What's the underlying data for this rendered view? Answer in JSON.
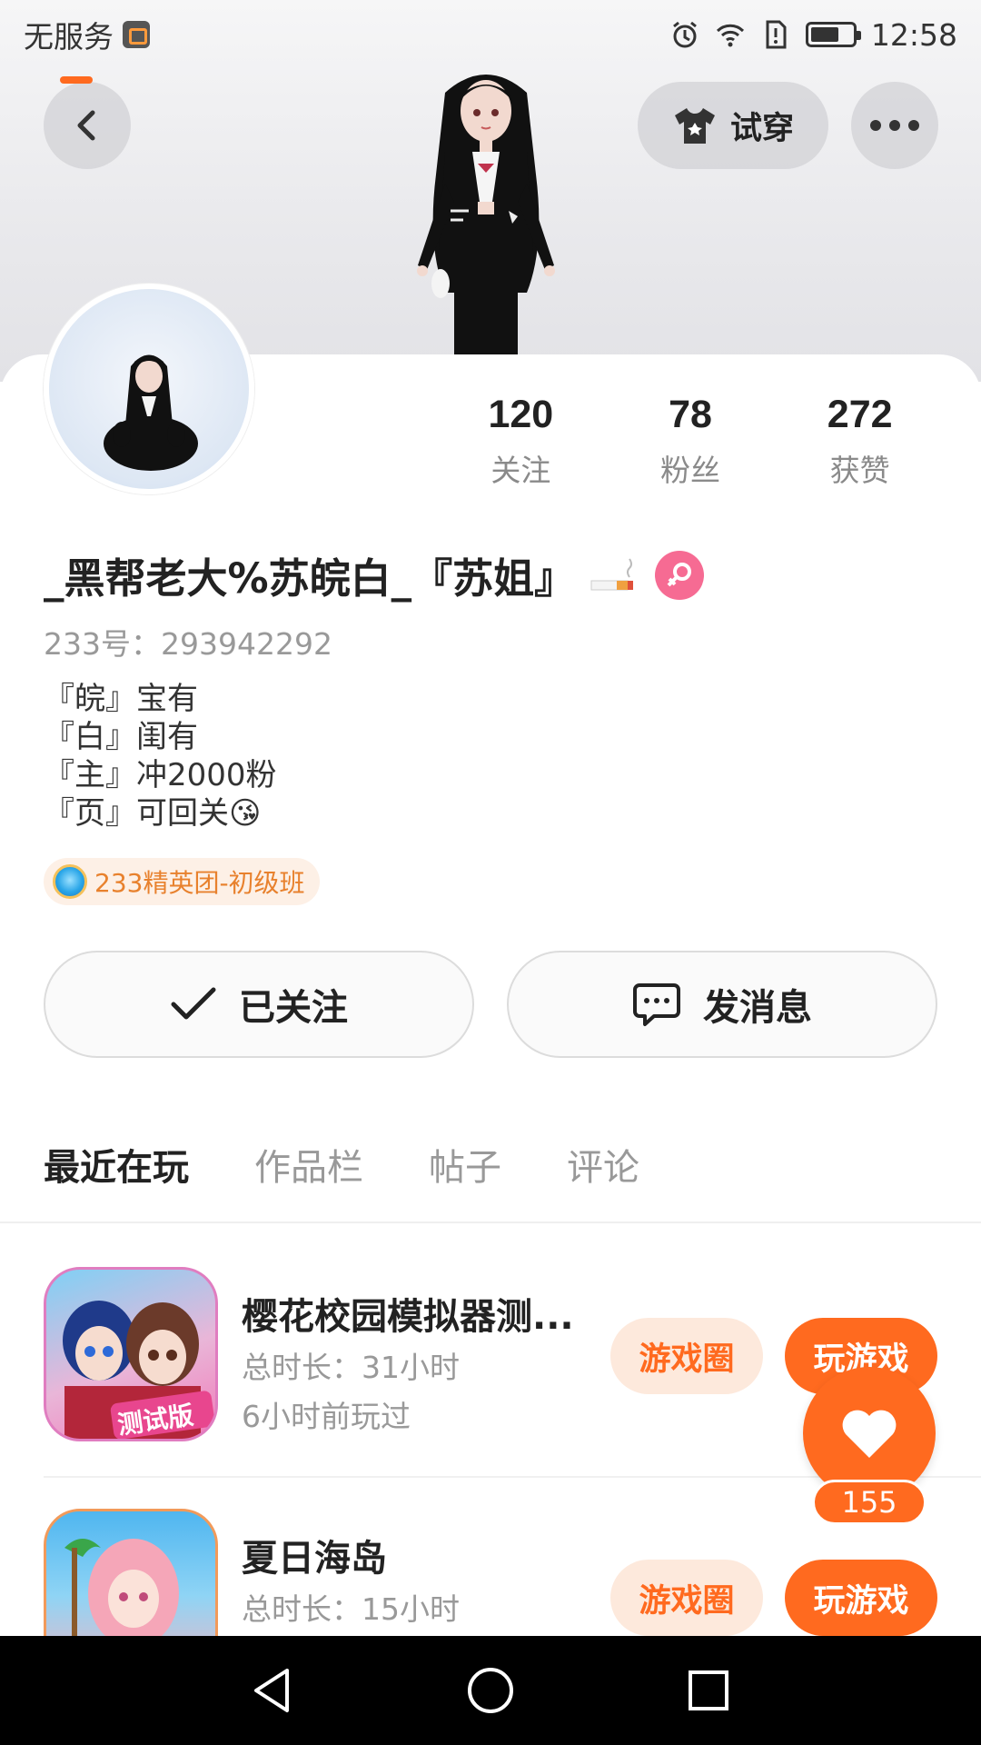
{
  "status_bar": {
    "carrier": "无服务",
    "time": "12:58"
  },
  "header": {
    "tryon_label": "试穿"
  },
  "profile": {
    "nickname": "_黑帮老大%苏皖白_『苏姐』",
    "user_id_label": "233号：",
    "user_id": "293942292",
    "stats": [
      {
        "value": "120",
        "label": "关注"
      },
      {
        "value": "78",
        "label": "粉丝"
      },
      {
        "value": "272",
        "label": "获赞"
      }
    ],
    "bio": [
      "『皖』宝有",
      "『白』闺有",
      "『主』冲2000粉",
      "『页』可回关😘"
    ],
    "tag": "233精英团-初级班"
  },
  "actions": {
    "follow_label": "已关注",
    "message_label": "发消息"
  },
  "tabs": [
    {
      "label": "最近在玩",
      "active": true
    },
    {
      "label": "作品栏",
      "active": false
    },
    {
      "label": "帖子",
      "active": false
    },
    {
      "label": "评论",
      "active": false
    }
  ],
  "games": [
    {
      "title": "樱花校园模拟器测...",
      "duration": "总时长：31小时",
      "last_played": "6小时前玩过",
      "circle_label": "游戏圈",
      "play_label": "玩游戏",
      "icon_badge": "测试版"
    },
    {
      "title": "夏日海岛",
      "duration": "总时长：15小时",
      "last_played": "",
      "circle_label": "游戏圈",
      "play_label": "玩游戏"
    }
  ],
  "like": {
    "count": "155"
  },
  "colors": {
    "accent": "#ff6a1f",
    "accent_light": "#fde9dc",
    "gender_badge": "#f66b93",
    "tag_text": "#e8812d"
  }
}
